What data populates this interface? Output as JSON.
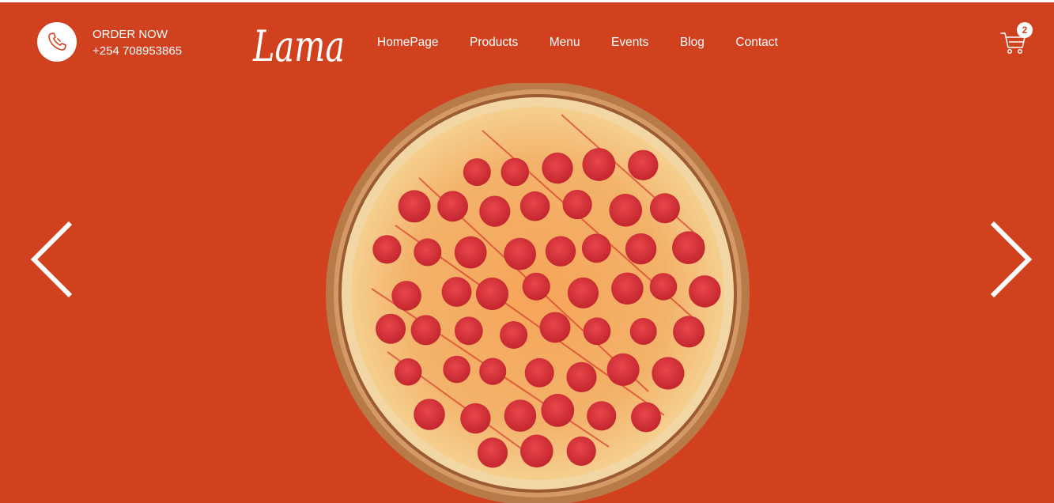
{
  "header": {
    "order_label": "ORDER NOW",
    "phone": "+254 708953865",
    "logo_text": "Lama",
    "nav": [
      "HomePage",
      "Products",
      "Menu",
      "Events",
      "Blog",
      "Contact"
    ],
    "cart_count": "2"
  },
  "icons": {
    "phone": "phone-icon",
    "cart": "cart-icon",
    "prev": "chevron-left-icon",
    "next": "chevron-right-icon"
  },
  "colors": {
    "background": "#d1411e",
    "text": "#ffffff"
  }
}
